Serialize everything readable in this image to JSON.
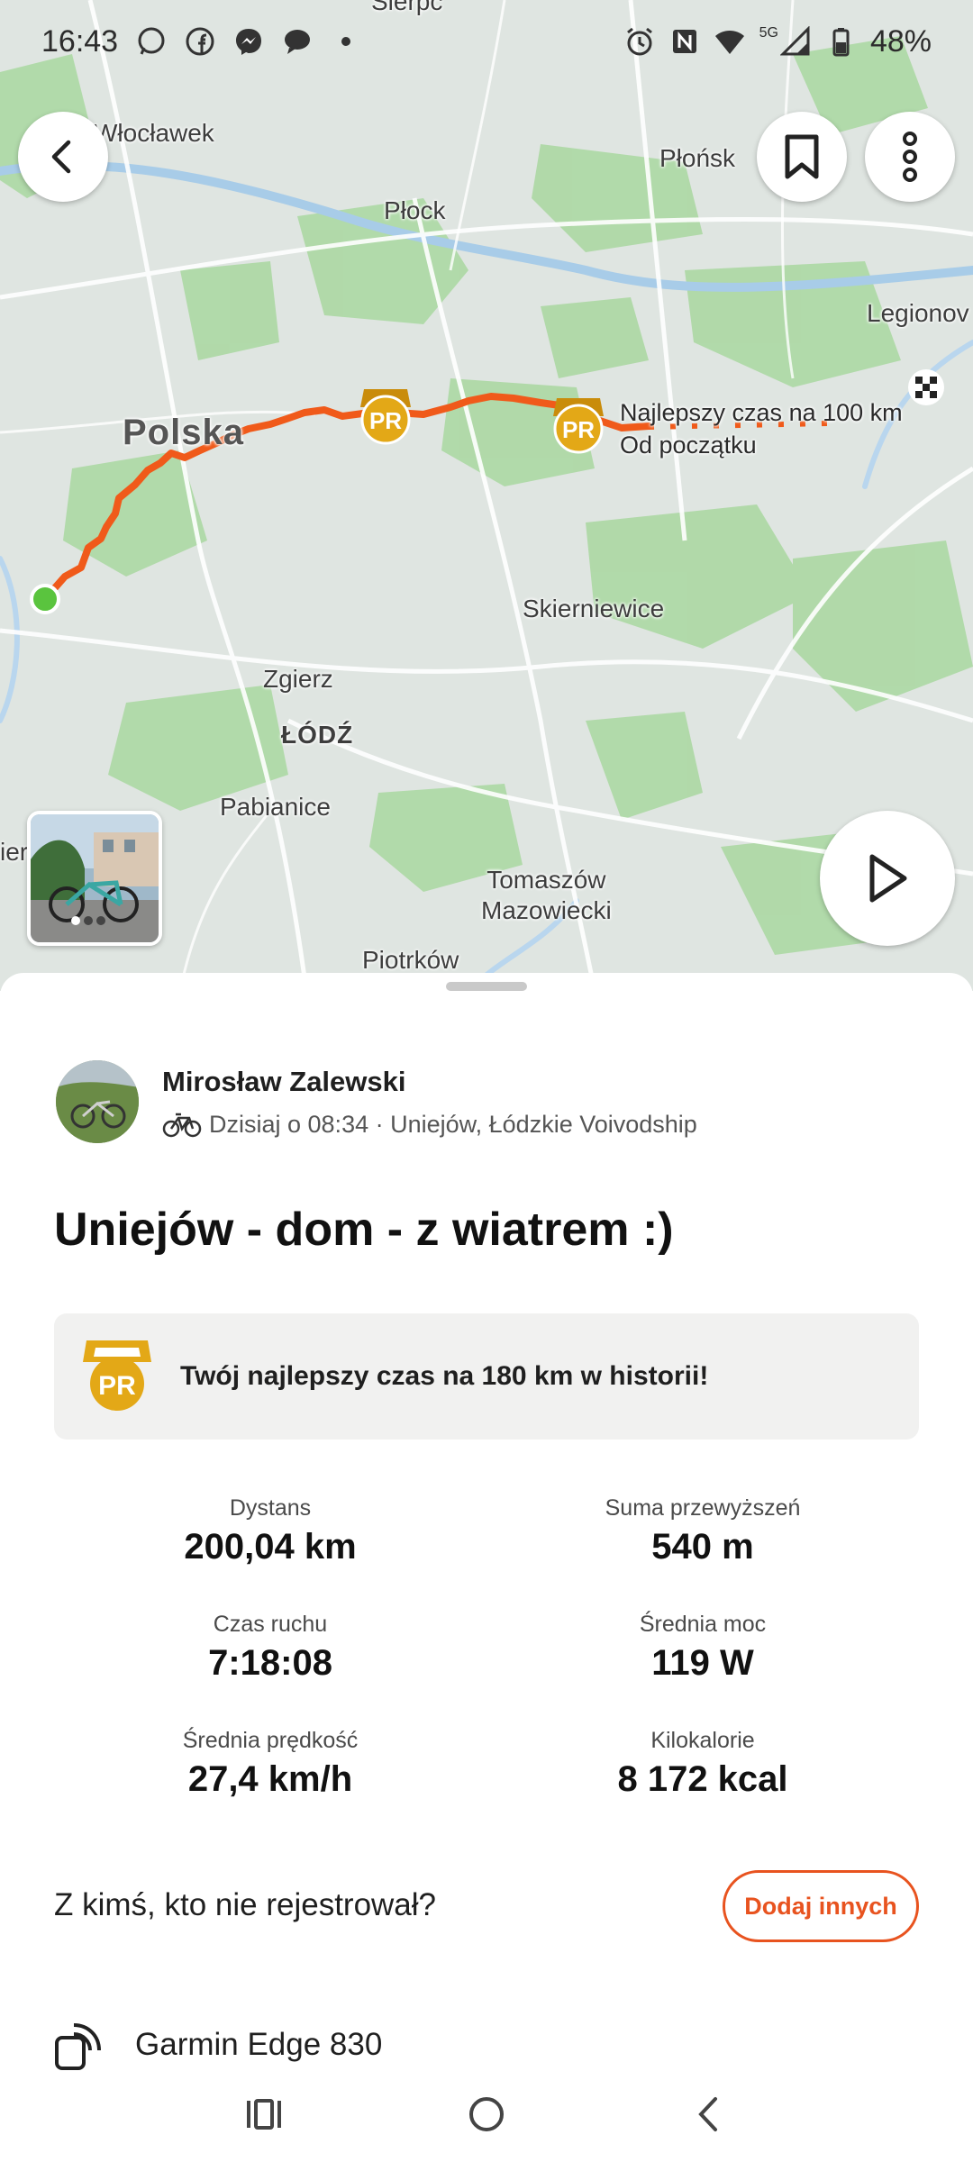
{
  "status_bar": {
    "time": "16:43",
    "battery": "48%",
    "network": "5G",
    "left_icons": [
      "whatsapp-icon",
      "facebook-icon",
      "messenger-icon",
      "chat-icon",
      "dot-icon"
    ],
    "right_icons": [
      "alarm-icon",
      "nfc-icon",
      "wifi-icon",
      "signal-icon",
      "battery-icon"
    ]
  },
  "map": {
    "labels": {
      "wloclawek": "Włocławek",
      "sierpc": "Sierpc",
      "plonsk": "Płońsk",
      "plock": "Płock",
      "legionowo": "Legionov",
      "polska": "Polska",
      "skierniewice": "Skierniewice",
      "zgierz": "Zgierz",
      "lodz": "ŁÓDŹ",
      "pabianice": "Pabianice",
      "tomaszow": "Tomaszów\nMazowiecki",
      "piotrkow": "Piotrków",
      "edge_ier": "ier"
    },
    "pr_tooltip": {
      "line1": "Najlepszy czas na 100 km",
      "line2": "Od początku"
    },
    "pr_badge_text": "PR",
    "route_color": "#f05a1a",
    "start_color": "#5ac43e"
  },
  "activity": {
    "athlete_name": "Mirosław Zalewski",
    "date_location": "Dzisiaj o 08:34 · Uniejów, Łódzkie Voivodship",
    "title": "Uniejów - dom - z wiatrem :)",
    "pr_banner": "Twój najlepszy czas na 180 km w historii!",
    "stats": {
      "distance": {
        "label": "Dystans",
        "value": "200,04 km"
      },
      "elevation": {
        "label": "Suma przewyższeń",
        "value": "540 m"
      },
      "moving_time": {
        "label": "Czas ruchu",
        "value": "7:18:08"
      },
      "avg_power": {
        "label": "Średnia moc",
        "value": "119 W"
      },
      "avg_speed": {
        "label": "Średnia prędkość",
        "value": "27,4 km/h"
      },
      "calories": {
        "label": "Kilokalorie",
        "value": "8 172 kcal"
      }
    },
    "with_others_text": "Z kimś, kto nie rejestrował?",
    "add_others_label": "Dodaj innych",
    "device": "Garmin Edge 830"
  },
  "colors": {
    "accent": "#e8531f",
    "pr_gold": "#e3a817"
  }
}
